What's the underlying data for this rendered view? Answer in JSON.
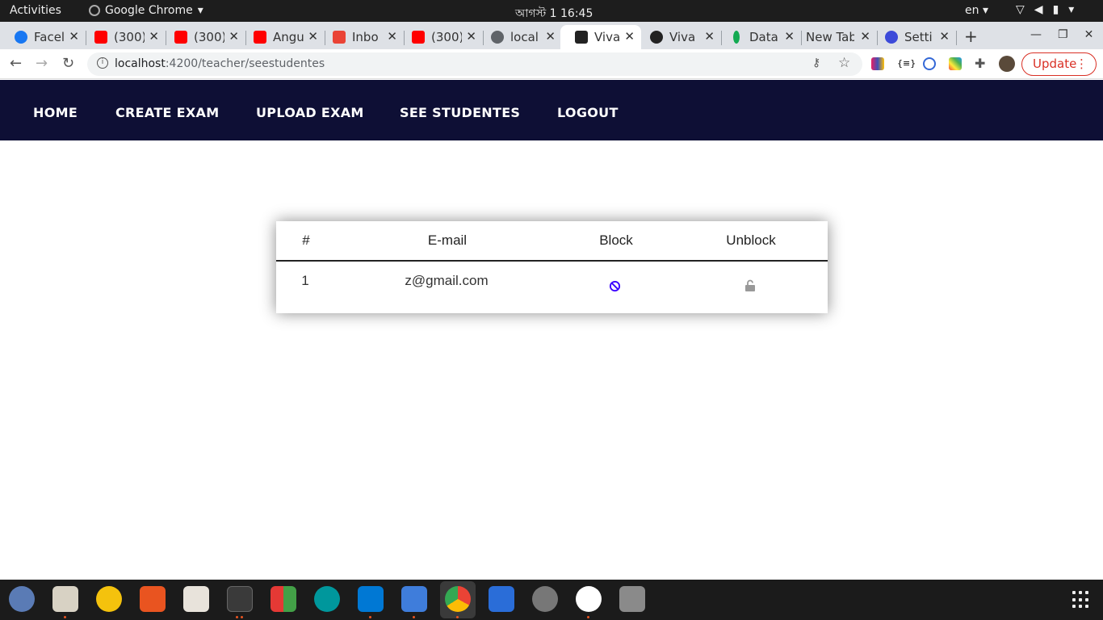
{
  "system": {
    "activities": "Activities",
    "app_name": "Google Chrome",
    "clock": "আগস্ট 1  16:45",
    "lang": "en"
  },
  "tabs": [
    {
      "label": "Facel",
      "color": "#1877f2"
    },
    {
      "label": "(300)",
      "color": "#ff0000"
    },
    {
      "label": "(300)",
      "color": "#ff0000"
    },
    {
      "label": "Angu",
      "color": "#ff0000"
    },
    {
      "label": "Inbo",
      "color": "#ea4335"
    },
    {
      "label": "(300)",
      "color": "#ff0000"
    },
    {
      "label": "local",
      "color": "#5f6368"
    },
    {
      "label": "Viva",
      "color": "#222222"
    },
    {
      "label": "Viva",
      "color": "#222222"
    },
    {
      "label": "Data",
      "color": "#13aa52"
    },
    {
      "label": "New Tab",
      "color": ""
    },
    {
      "label": "Setti",
      "color": "#3c4ad9"
    }
  ],
  "address": {
    "host": "localhost",
    "path": ":4200/teacher/seestudentes"
  },
  "update_label": "Update",
  "nav": {
    "home": "HOME",
    "create_exam": "CREATE EXAM",
    "upload_exam": "UPLOAD EXAM",
    "see_students": "SEE STUDENTES",
    "logout": "LOGOUT"
  },
  "table": {
    "headers": [
      "#",
      "E-mail",
      "Block",
      "Unblock"
    ],
    "rows": [
      {
        "index": "1",
        "email": "z@gmail.com",
        "block_icon": "block-icon",
        "unblock_icon": "unlock-icon"
      }
    ]
  },
  "colors": {
    "nav_bg": "#0e0f35",
    "block_icon": "#3b00ff",
    "unlock_icon": "#999999",
    "update_accent": "#d93025"
  }
}
